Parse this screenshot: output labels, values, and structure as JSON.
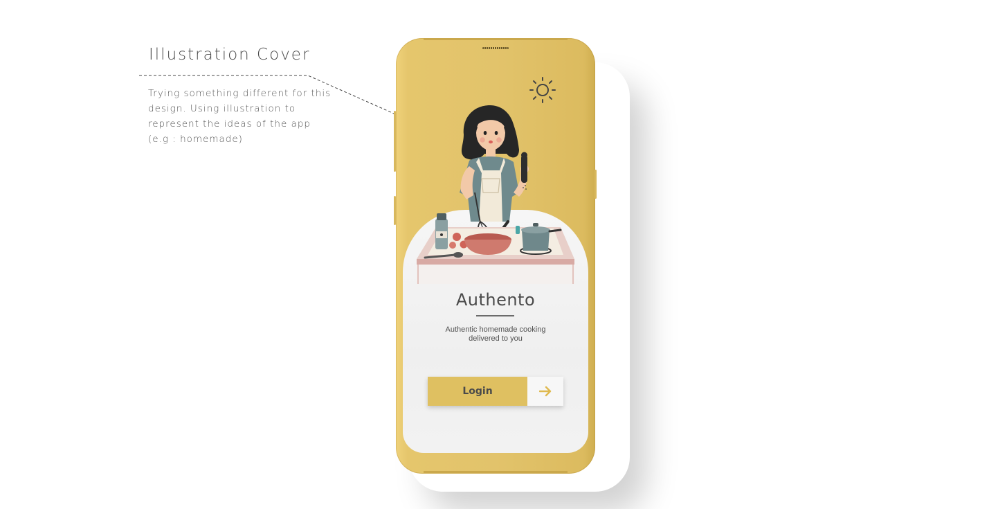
{
  "annotation": {
    "title": "Illustration Cover",
    "lines": [
      "Trying something different for this",
      "design. Using illustration to",
      "represent the ideas of the app",
      "(e.g : homemade)"
    ]
  },
  "app": {
    "name": "Authento",
    "tagline_line1": "Authentic homemade cooking",
    "tagline_line2": "delivered to you",
    "login_label": "Login",
    "theme_icon": "sun-icon",
    "arrow_icon": "arrow-right-icon"
  },
  "colors": {
    "phone_body": "#e2c36b",
    "card": "#f1f1f1",
    "login_button": "#dfc061",
    "arrow": "#dfb94f",
    "text": "#4a4a4a"
  }
}
